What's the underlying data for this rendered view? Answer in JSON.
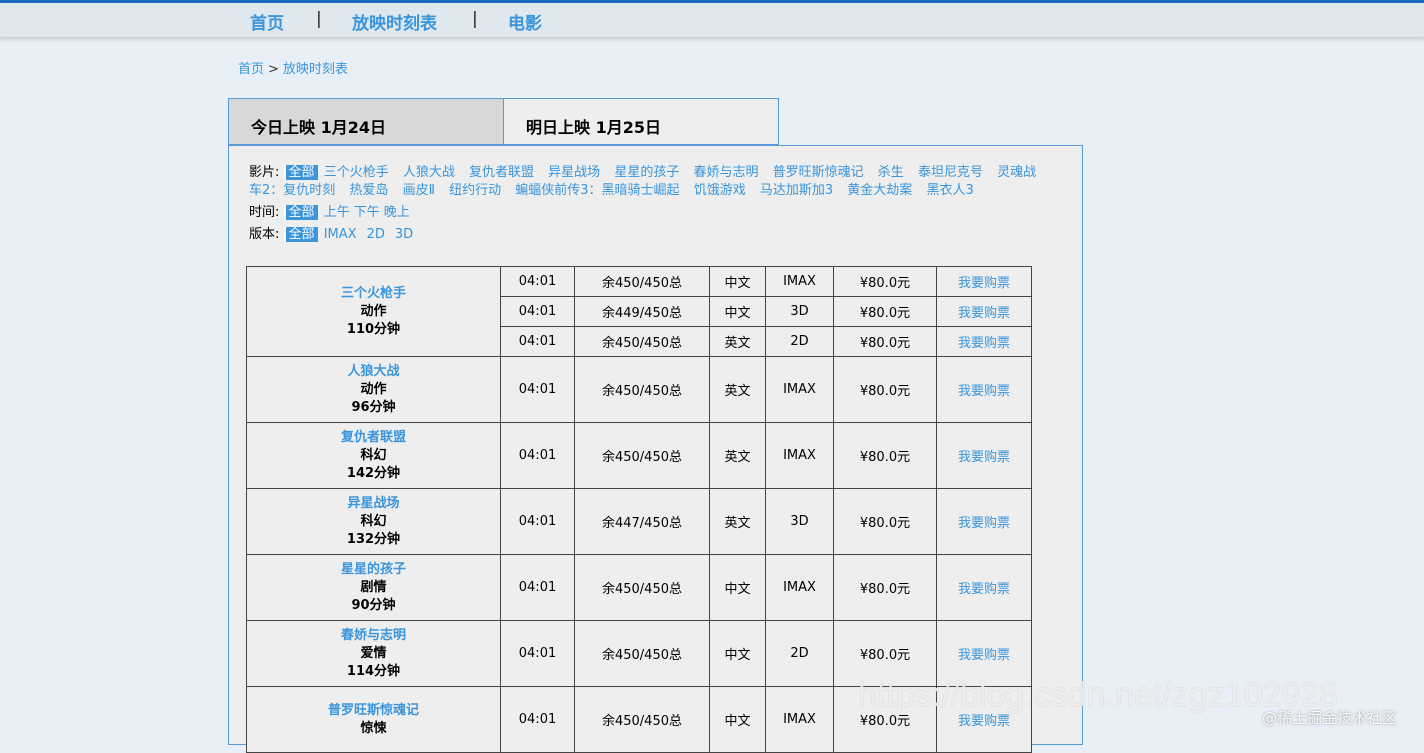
{
  "nav": {
    "items": [
      "首页",
      "放映时刻表",
      "电影"
    ],
    "separator": "|"
  },
  "breadcrumb": {
    "home": "首页",
    "separator": ">",
    "current": "放映时刻表"
  },
  "tabs": [
    {
      "label": "今日上映 1月24日",
      "active": true
    },
    {
      "label": "明日上映 1月25日",
      "active": false
    }
  ],
  "filters": {
    "movie_label": "影片:",
    "movie_all": "全部",
    "movies": [
      "三个火枪手",
      "人狼大战",
      "复仇者联盟",
      "异星战场",
      "星星的孩子",
      "春娇与志明",
      "普罗旺斯惊魂记",
      "杀生",
      "泰坦尼克号",
      "灵魂战车2：复仇时刻",
      "热爱岛",
      "画皮Ⅱ",
      "纽约行动",
      "蝙蝠侠前传3：黑暗骑士崛起",
      "饥饿游戏",
      "马达加斯加3",
      "黄金大劫案",
      "黑衣人3"
    ],
    "time_label": "时间:",
    "time_all": "全部",
    "times": [
      "上午",
      "下午",
      "晚上"
    ],
    "version_label": "版本:",
    "version_all": "全部",
    "versions": [
      "IMAX",
      "2D",
      "3D"
    ]
  },
  "schedule": {
    "buy_label": "我要购票",
    "movies": [
      {
        "name": "三个火枪手",
        "genre": "动作",
        "duration": "110分钟",
        "shows": [
          {
            "time": "04:01",
            "seats": "余450/450总",
            "lang": "中文",
            "version": "IMAX",
            "price": "¥80.0元"
          },
          {
            "time": "04:01",
            "seats": "余449/450总",
            "lang": "中文",
            "version": "3D",
            "price": "¥80.0元"
          },
          {
            "time": "04:01",
            "seats": "余450/450总",
            "lang": "英文",
            "version": "2D",
            "price": "¥80.0元"
          }
        ]
      },
      {
        "name": "人狼大战",
        "genre": "动作",
        "duration": "96分钟",
        "shows": [
          {
            "time": "04:01",
            "seats": "余450/450总",
            "lang": "英文",
            "version": "IMAX",
            "price": "¥80.0元"
          }
        ]
      },
      {
        "name": "复仇者联盟",
        "genre": "科幻",
        "duration": "142分钟",
        "shows": [
          {
            "time": "04:01",
            "seats": "余450/450总",
            "lang": "英文",
            "version": "IMAX",
            "price": "¥80.0元"
          }
        ]
      },
      {
        "name": "异星战场",
        "genre": "科幻",
        "duration": "132分钟",
        "shows": [
          {
            "time": "04:01",
            "seats": "余447/450总",
            "lang": "英文",
            "version": "3D",
            "price": "¥80.0元"
          }
        ]
      },
      {
        "name": "星星的孩子",
        "genre": "剧情",
        "duration": "90分钟",
        "shows": [
          {
            "time": "04:01",
            "seats": "余450/450总",
            "lang": "中文",
            "version": "IMAX",
            "price": "¥80.0元"
          }
        ]
      },
      {
        "name": "春娇与志明",
        "genre": "爱情",
        "duration": "114分钟",
        "shows": [
          {
            "time": "04:01",
            "seats": "余450/450总",
            "lang": "中文",
            "version": "2D",
            "price": "¥80.0元"
          }
        ]
      },
      {
        "name": "普罗旺斯惊魂记",
        "genre": "惊悚",
        "duration": "",
        "shows": [
          {
            "time": "04:01",
            "seats": "余450/450总",
            "lang": "中文",
            "version": "IMAX",
            "price": "¥80.0元"
          }
        ]
      }
    ]
  },
  "watermark": {
    "url": "https://blog.csdn.net/zgz102928",
    "community": "@稀土掘金技术社区"
  }
}
